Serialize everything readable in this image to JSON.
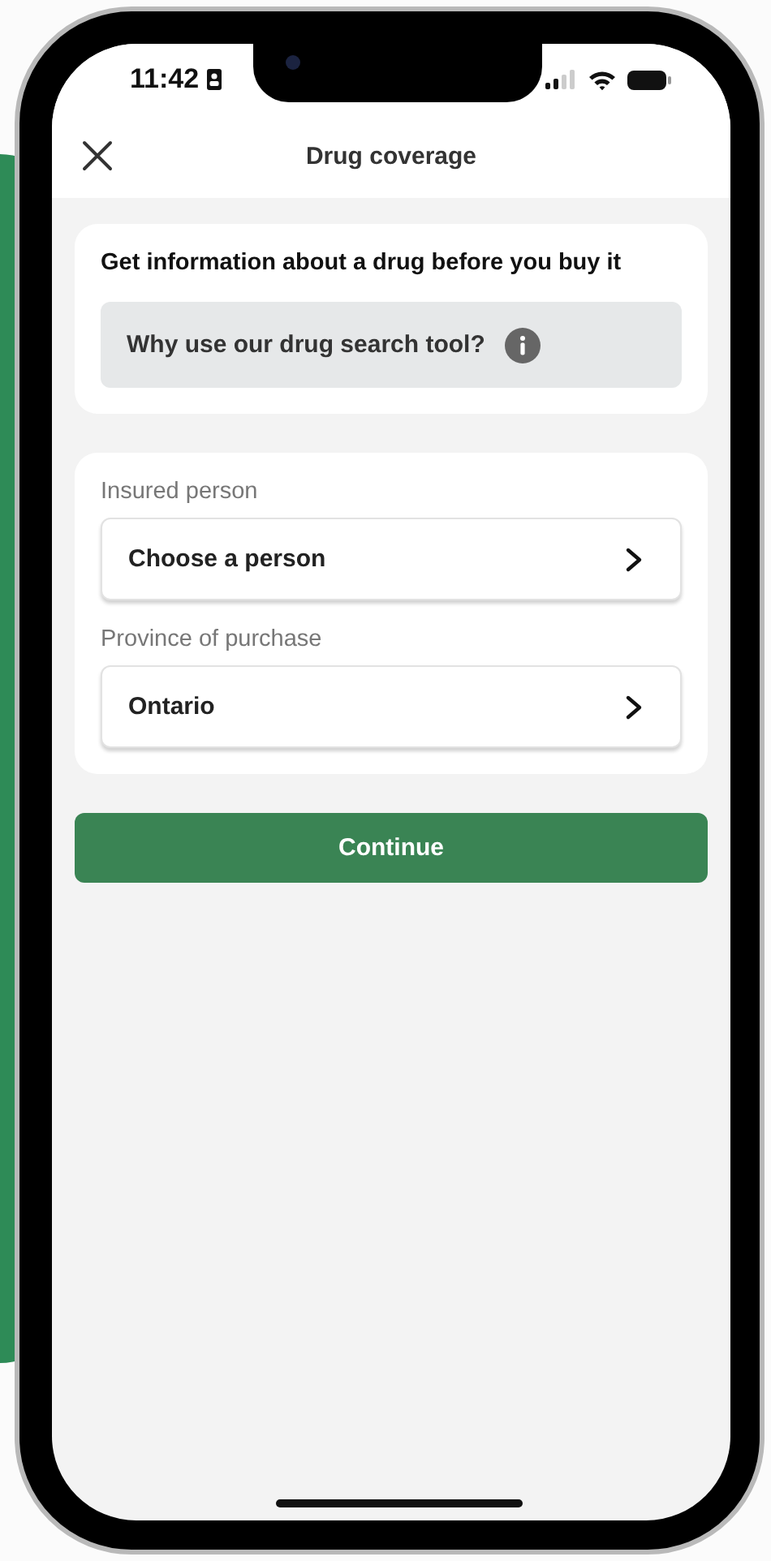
{
  "status_bar": {
    "time": "11:42"
  },
  "header": {
    "title": "Drug coverage"
  },
  "intro_card": {
    "heading": "Get information about a drug before you buy it",
    "info_button": "Why use our drug search tool?"
  },
  "form": {
    "fields": [
      {
        "label": "Insured person",
        "value": "Choose a person"
      },
      {
        "label": "Province of purchase",
        "value": "Ontario"
      }
    ]
  },
  "primary_button": "Continue"
}
